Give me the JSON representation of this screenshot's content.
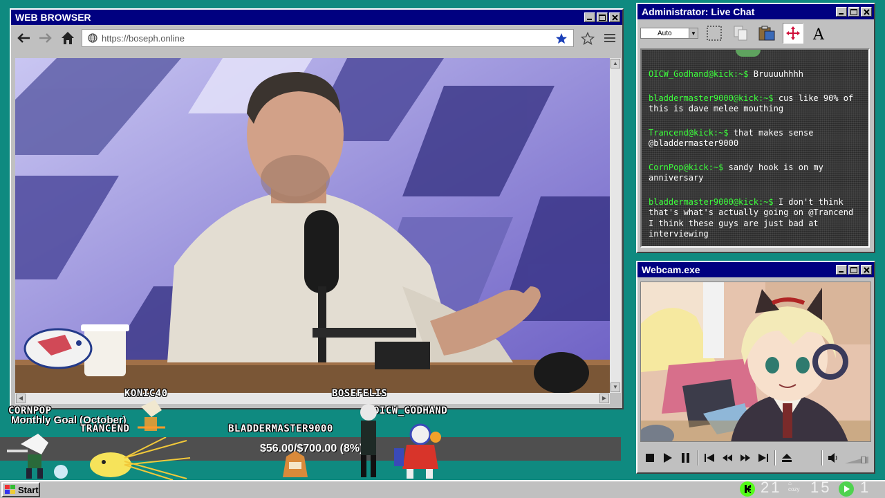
{
  "browser": {
    "title": "WEB BROWSER",
    "url": "https://boseph.online"
  },
  "chat": {
    "title": "Administrator: Live Chat",
    "select_value": "Auto",
    "messages": [
      {
        "user": "OICW_Godhand@kick:~$",
        "text": "Bruuuuhhhh"
      },
      {
        "user": "bladdermaster9000@kick:~$",
        "text": "cus like 90% of this is dave melee mouthing"
      },
      {
        "user": "Trancend@kick:~$",
        "text": "that makes sense @bladdermaster9000"
      },
      {
        "user": "CornPop@kick:~$",
        "text": "sandy hook is on my anniversary"
      },
      {
        "user": "bladdermaster9000@kick:~$",
        "text": "I don't think that's what's actually going on @Trancend I think these guys are just bad at interviewing"
      }
    ]
  },
  "webcam": {
    "title": "Webcam.exe"
  },
  "overlay": {
    "goal_title": "Monthly Goal (October)",
    "goal_amount": "$56.00/$700.00 (8%)",
    "goal_fraction": 0.08,
    "names": {
      "konic": "KONIC40",
      "cornpop": "CORNPOP",
      "trancend": "TRANCEND",
      "bladder": "BLADDERMASTER9000",
      "bosefelis": "BOSEFELIS",
      "oicw": "OICW_GODHAND"
    }
  },
  "taskbar": {
    "start_label": "Start",
    "kick_count": "21",
    "cozy_label": "cozy",
    "cozy_count": "15",
    "play_count": "1"
  },
  "colors": {
    "desktop": "#0f8a80",
    "titlebar": "#000080",
    "chat_user": "#3cff3c",
    "kick_green": "#53fc18"
  }
}
